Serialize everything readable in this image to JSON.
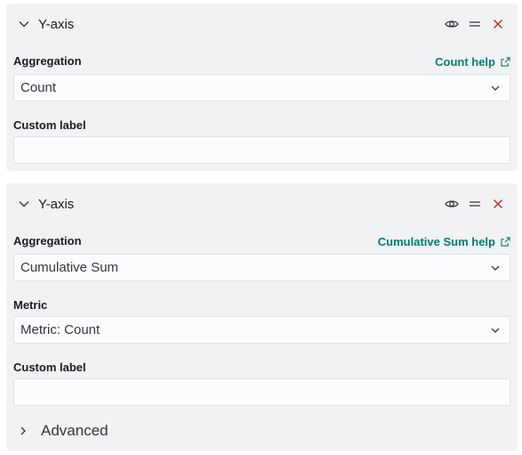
{
  "panels": [
    {
      "title": "Y-axis",
      "aggregation_label": "Aggregation",
      "help_link": "Count help",
      "aggregation_value": "Count",
      "custom_label_label": "Custom label",
      "custom_label_value": ""
    },
    {
      "title": "Y-axis",
      "aggregation_label": "Aggregation",
      "help_link": "Cumulative Sum help",
      "aggregation_value": "Cumulative Sum",
      "metric_label": "Metric",
      "metric_value": "Metric: Count",
      "custom_label_label": "Custom label",
      "custom_label_value": "",
      "advanced_label": "Advanced"
    }
  ],
  "icons": {
    "toggle": "eye-icon",
    "drag": "drag-handle-icon",
    "remove": "close-icon",
    "collapse": "chevron-down-icon",
    "expand": "chevron-right-icon",
    "external": "external-link-icon",
    "select_caret": "chevron-down-icon"
  },
  "colors": {
    "panel_bg": "#f1f2f4",
    "link": "#017d73",
    "danger": "#bd271e",
    "text": "#343741"
  }
}
